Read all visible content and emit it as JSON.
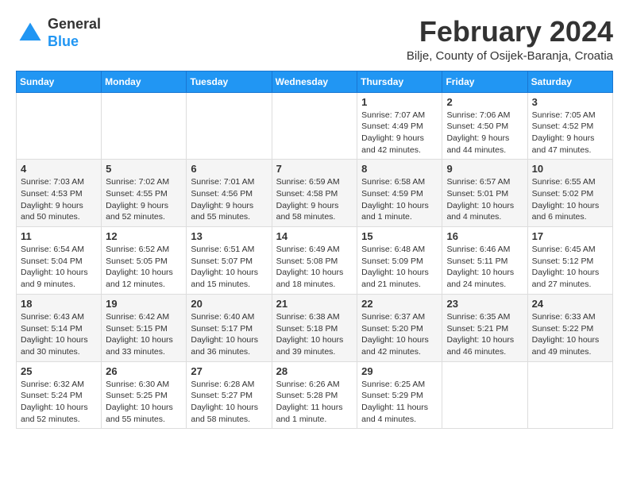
{
  "header": {
    "logo": {
      "general": "General",
      "blue": "Blue"
    },
    "title": "February 2024",
    "location": "Bilje, County of Osijek-Baranja, Croatia"
  },
  "days_of_week": [
    "Sunday",
    "Monday",
    "Tuesday",
    "Wednesday",
    "Thursday",
    "Friday",
    "Saturday"
  ],
  "weeks": [
    [
      {
        "day": "",
        "info": ""
      },
      {
        "day": "",
        "info": ""
      },
      {
        "day": "",
        "info": ""
      },
      {
        "day": "",
        "info": ""
      },
      {
        "day": "1",
        "info": "Sunrise: 7:07 AM\nSunset: 4:49 PM\nDaylight: 9 hours\nand 42 minutes."
      },
      {
        "day": "2",
        "info": "Sunrise: 7:06 AM\nSunset: 4:50 PM\nDaylight: 9 hours\nand 44 minutes."
      },
      {
        "day": "3",
        "info": "Sunrise: 7:05 AM\nSunset: 4:52 PM\nDaylight: 9 hours\nand 47 minutes."
      }
    ],
    [
      {
        "day": "4",
        "info": "Sunrise: 7:03 AM\nSunset: 4:53 PM\nDaylight: 9 hours\nand 50 minutes."
      },
      {
        "day": "5",
        "info": "Sunrise: 7:02 AM\nSunset: 4:55 PM\nDaylight: 9 hours\nand 52 minutes."
      },
      {
        "day": "6",
        "info": "Sunrise: 7:01 AM\nSunset: 4:56 PM\nDaylight: 9 hours\nand 55 minutes."
      },
      {
        "day": "7",
        "info": "Sunrise: 6:59 AM\nSunset: 4:58 PM\nDaylight: 9 hours\nand 58 minutes."
      },
      {
        "day": "8",
        "info": "Sunrise: 6:58 AM\nSunset: 4:59 PM\nDaylight: 10 hours\nand 1 minute."
      },
      {
        "day": "9",
        "info": "Sunrise: 6:57 AM\nSunset: 5:01 PM\nDaylight: 10 hours\nand 4 minutes."
      },
      {
        "day": "10",
        "info": "Sunrise: 6:55 AM\nSunset: 5:02 PM\nDaylight: 10 hours\nand 6 minutes."
      }
    ],
    [
      {
        "day": "11",
        "info": "Sunrise: 6:54 AM\nSunset: 5:04 PM\nDaylight: 10 hours\nand 9 minutes."
      },
      {
        "day": "12",
        "info": "Sunrise: 6:52 AM\nSunset: 5:05 PM\nDaylight: 10 hours\nand 12 minutes."
      },
      {
        "day": "13",
        "info": "Sunrise: 6:51 AM\nSunset: 5:07 PM\nDaylight: 10 hours\nand 15 minutes."
      },
      {
        "day": "14",
        "info": "Sunrise: 6:49 AM\nSunset: 5:08 PM\nDaylight: 10 hours\nand 18 minutes."
      },
      {
        "day": "15",
        "info": "Sunrise: 6:48 AM\nSunset: 5:09 PM\nDaylight: 10 hours\nand 21 minutes."
      },
      {
        "day": "16",
        "info": "Sunrise: 6:46 AM\nSunset: 5:11 PM\nDaylight: 10 hours\nand 24 minutes."
      },
      {
        "day": "17",
        "info": "Sunrise: 6:45 AM\nSunset: 5:12 PM\nDaylight: 10 hours\nand 27 minutes."
      }
    ],
    [
      {
        "day": "18",
        "info": "Sunrise: 6:43 AM\nSunset: 5:14 PM\nDaylight: 10 hours\nand 30 minutes."
      },
      {
        "day": "19",
        "info": "Sunrise: 6:42 AM\nSunset: 5:15 PM\nDaylight: 10 hours\nand 33 minutes."
      },
      {
        "day": "20",
        "info": "Sunrise: 6:40 AM\nSunset: 5:17 PM\nDaylight: 10 hours\nand 36 minutes."
      },
      {
        "day": "21",
        "info": "Sunrise: 6:38 AM\nSunset: 5:18 PM\nDaylight: 10 hours\nand 39 minutes."
      },
      {
        "day": "22",
        "info": "Sunrise: 6:37 AM\nSunset: 5:20 PM\nDaylight: 10 hours\nand 42 minutes."
      },
      {
        "day": "23",
        "info": "Sunrise: 6:35 AM\nSunset: 5:21 PM\nDaylight: 10 hours\nand 46 minutes."
      },
      {
        "day": "24",
        "info": "Sunrise: 6:33 AM\nSunset: 5:22 PM\nDaylight: 10 hours\nand 49 minutes."
      }
    ],
    [
      {
        "day": "25",
        "info": "Sunrise: 6:32 AM\nSunset: 5:24 PM\nDaylight: 10 hours\nand 52 minutes."
      },
      {
        "day": "26",
        "info": "Sunrise: 6:30 AM\nSunset: 5:25 PM\nDaylight: 10 hours\nand 55 minutes."
      },
      {
        "day": "27",
        "info": "Sunrise: 6:28 AM\nSunset: 5:27 PM\nDaylight: 10 hours\nand 58 minutes."
      },
      {
        "day": "28",
        "info": "Sunrise: 6:26 AM\nSunset: 5:28 PM\nDaylight: 11 hours\nand 1 minute."
      },
      {
        "day": "29",
        "info": "Sunrise: 6:25 AM\nSunset: 5:29 PM\nDaylight: 11 hours\nand 4 minutes."
      },
      {
        "day": "",
        "info": ""
      },
      {
        "day": "",
        "info": ""
      }
    ]
  ]
}
